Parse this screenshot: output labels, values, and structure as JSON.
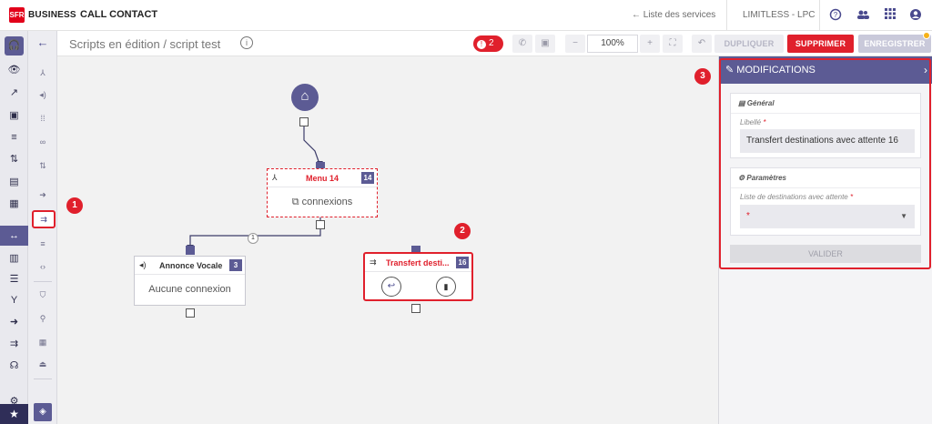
{
  "header": {
    "logo_text": "SFR",
    "brand": "BUSINESS",
    "app_title": "CALL CONTACT",
    "services_link": "← Liste des services",
    "account": "LIMITLESS - LPC",
    "icons": [
      "help-icon",
      "users-icon",
      "apps-grid-icon",
      "profile-icon"
    ]
  },
  "sidebar": {
    "items": [
      "headset-icon",
      "eye-icon",
      "trend-icon",
      "save-icon",
      "queue-icon",
      "transfer-icon",
      "message-icon",
      "contact-card-icon",
      "link-icon",
      "calendar-icon",
      "list-icon",
      "branch-icon",
      "forward-icon",
      "transfer-dest-icon",
      "headset-small-icon",
      "gear-icon",
      "star-icon"
    ],
    "active": "link-icon"
  },
  "toolbar": {
    "breadcrumb": "Scripts en édition / script test",
    "alert_count": "2",
    "zoom": "100%",
    "duplicate": "DUPLIQUER",
    "delete": "SUPPRIMER",
    "save": "ENREGISTRER"
  },
  "canvas": {
    "menu_node": {
      "title": "Menu 14",
      "number": "14",
      "body": "connexions"
    },
    "voice_node": {
      "title": "Annonce Vocale",
      "number": "3",
      "body": "Aucune connexion"
    },
    "transfer_node": {
      "title": "Transfert desti...",
      "number": "16"
    },
    "edge_label": "1"
  },
  "panel": {
    "title": "MODIFICATIONS",
    "general": {
      "heading": "Général",
      "label": "Libellé",
      "required": "*",
      "value": "Transfert destinations avec attente 16"
    },
    "params": {
      "heading": "Paramètres",
      "label": "Liste de destinations avec attente",
      "required": "*",
      "value": "*"
    },
    "validate": "VALIDER"
  },
  "callouts": [
    "1",
    "2",
    "3"
  ],
  "colors": {
    "accent": "#5c5b94",
    "danger": "#e0202c",
    "warning": "#f6b21a"
  }
}
